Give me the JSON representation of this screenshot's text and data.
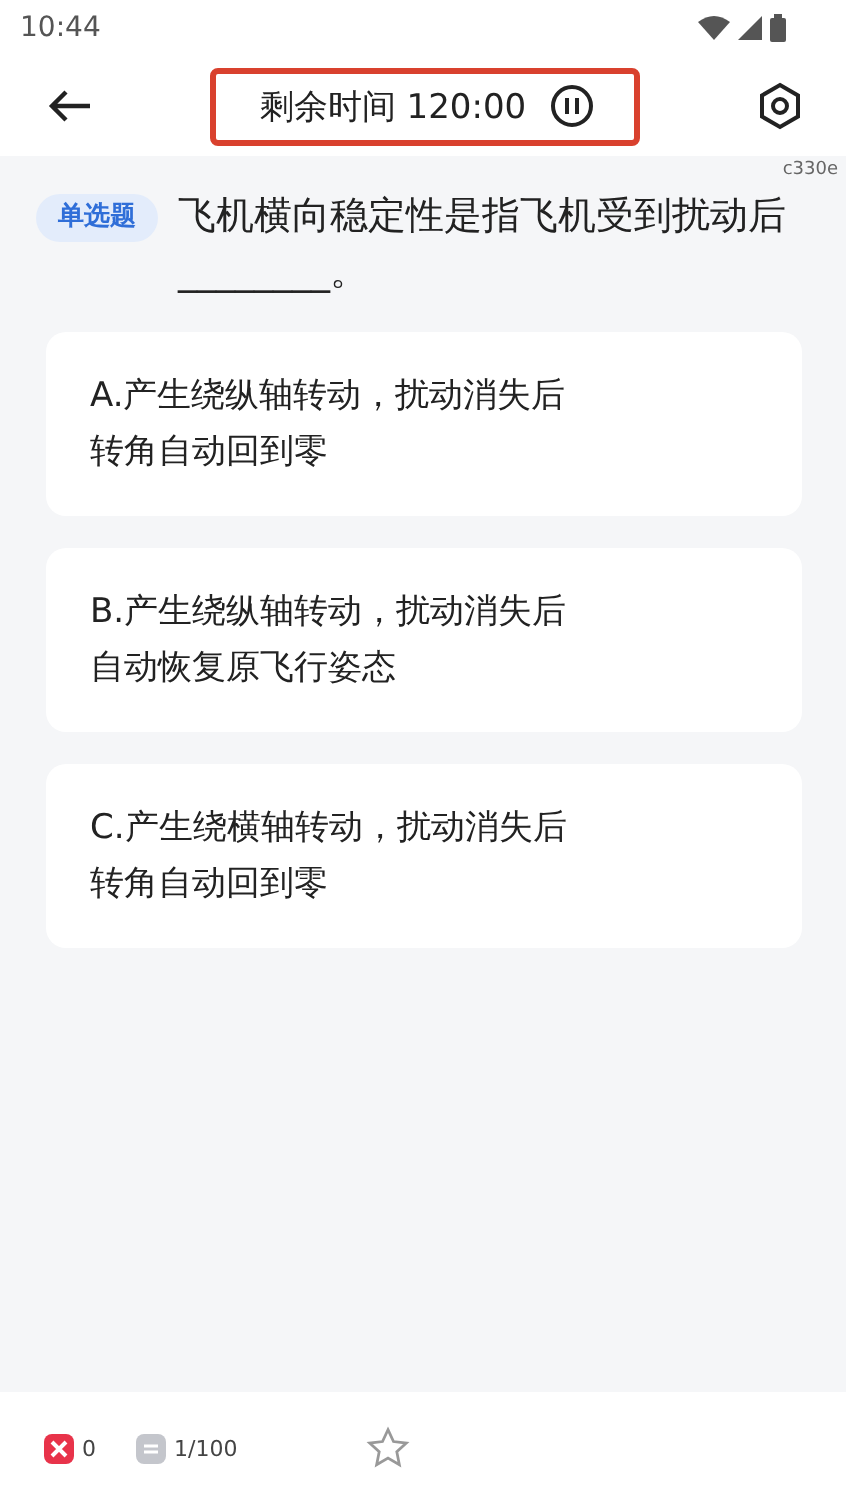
{
  "status_bar": {
    "time": "10:44"
  },
  "header": {
    "timer_label": "剩余时间 120:00"
  },
  "version_code": "c330e",
  "question": {
    "type_tag": "单选题",
    "text": "飞机横向稳定性是指飞机受到扰动后________。"
  },
  "options": [
    {
      "text": "A.产生绕纵轴转动，扰动消失后转角自动回到零",
      "selected": false
    },
    {
      "text": "B.产生绕纵轴转动，扰动消失后自动恢复原飞行姿态",
      "selected": false
    },
    {
      "text": "C.产生绕横轴转动，扰动消失后转角自动回到零",
      "selected": false
    }
  ],
  "bottom_bar": {
    "wrong_count": "0",
    "progress": "1/100",
    "starred": false
  }
}
